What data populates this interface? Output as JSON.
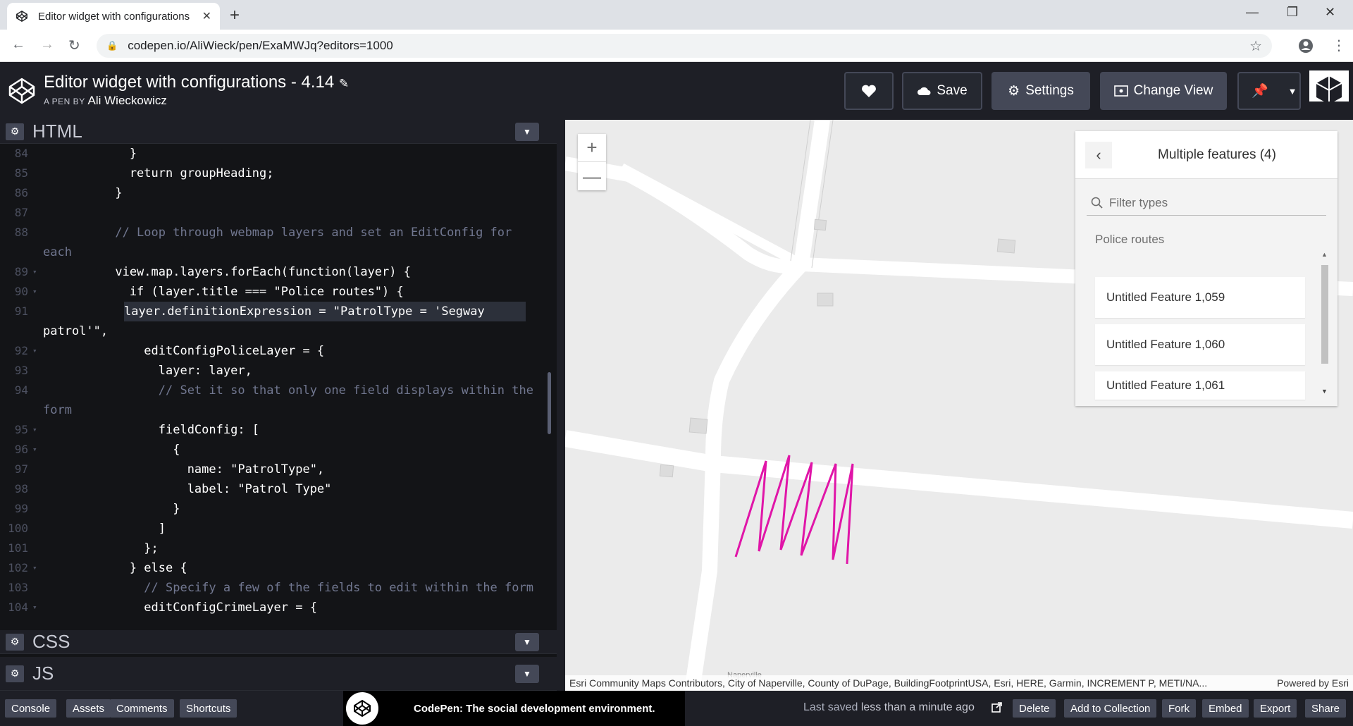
{
  "browser": {
    "tab_title": "Editor widget with configurations",
    "url": "codepen.io/AliWieck/pen/ExaMWJq?editors=1000"
  },
  "header": {
    "pen_title": "Editor widget with configurations - 4.14",
    "by_label": "A PEN BY",
    "author": "Ali Wieckowicz",
    "save": "Save",
    "settings": "Settings",
    "change_view": "Change View"
  },
  "editor": {
    "html_label": "HTML",
    "css_label": "CSS",
    "js_label": "JS",
    "lines": [
      {
        "n": "84",
        "text": "            }"
      },
      {
        "n": "85",
        "text": "            return groupHeading;"
      },
      {
        "n": "86",
        "text": "          }"
      },
      {
        "n": "87",
        "text": ""
      },
      {
        "n": "88",
        "text": "          // Loop through webmap layers and set an EditConfig for"
      },
      {
        "n": "",
        "text": "each"
      },
      {
        "n": "89",
        "text": "          view.map.layers.forEach(function(layer) {"
      },
      {
        "n": "90",
        "text": "            if (layer.title === \"Police routes\") {"
      },
      {
        "n": "91",
        "text": "               layer.definitionExpression = \"PatrolType = 'Segway"
      },
      {
        "n": "",
        "text": "patrol'\","
      },
      {
        "n": "92",
        "text": "              editConfigPoliceLayer = {"
      },
      {
        "n": "93",
        "text": "                layer: layer,"
      },
      {
        "n": "94",
        "text": "                // Set it so that only one field displays within the"
      },
      {
        "n": "",
        "text": "form"
      },
      {
        "n": "95",
        "text": "                fieldConfig: ["
      },
      {
        "n": "96",
        "text": "                  {"
      },
      {
        "n": "97",
        "text": "                    name: \"PatrolType\","
      },
      {
        "n": "98",
        "text": "                    label: \"Patrol Type\""
      },
      {
        "n": "99",
        "text": "                  }"
      },
      {
        "n": "100",
        "text": "                ]"
      },
      {
        "n": "101",
        "text": "              };"
      },
      {
        "n": "102",
        "text": "            } else {"
      },
      {
        "n": "103",
        "text": "              // Specify a few of the fields to edit within the form"
      },
      {
        "n": "104",
        "text": "              editConfigCrimeLayer = {"
      }
    ]
  },
  "map": {
    "widget_title": "Multiple features (4)",
    "filter_placeholder": "Filter types",
    "group": "Police routes",
    "features": [
      "Untitled Feature 1,059",
      "Untitled Feature 1,060",
      "Untitled Feature 1,061"
    ],
    "attribution": "Esri Community Maps Contributors, City of Naperville, County of DuPage, BuildingFootprintUSA, Esri, HERE, Garmin, INCREMENT P, METI/NA...",
    "powered_by": "Powered by Esri",
    "place_label": "Naperville",
    "route_color": "#e016a8"
  },
  "footer": {
    "console": "Console",
    "assets": "Assets",
    "comments": "Comments",
    "shortcuts": "Shortcuts",
    "promo": "CodePen: The social development environment.",
    "saved_prefix": "Last saved",
    "saved_time": "less than a minute ago",
    "delete": "Delete",
    "add_to_collection": "Add to Collection",
    "fork": "Fork",
    "embed": "Embed",
    "export": "Export",
    "share": "Share"
  }
}
